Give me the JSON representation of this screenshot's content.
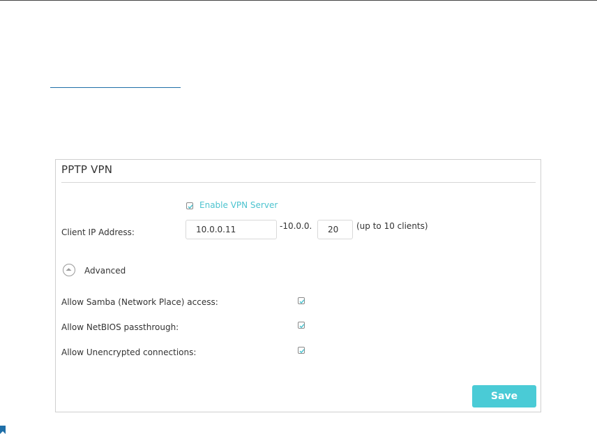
{
  "panel": {
    "title": "PPTP VPN",
    "enable_vpn_label": "Enable VPN Server",
    "enable_vpn_checked": true,
    "client_ip_label": "Client IP Address:",
    "client_ip_start_value": "10.0.0.11",
    "client_ip_separator": "-10.0.0.",
    "client_ip_end_value": "20",
    "client_limit_note": "(up to 10 clients)",
    "advanced_label": "Advanced",
    "options": [
      {
        "label": "Allow Samba (Network Place) access:",
        "checked": true
      },
      {
        "label": "Allow NetBIOS passthrough:",
        "checked": true
      },
      {
        "label": "Allow Unencrypted connections:",
        "checked": true
      }
    ],
    "save_label": "Save"
  },
  "colors": {
    "accent": "#4acbd6",
    "enable_text": "#4cc3cf",
    "link_line": "#1f6fa8"
  }
}
